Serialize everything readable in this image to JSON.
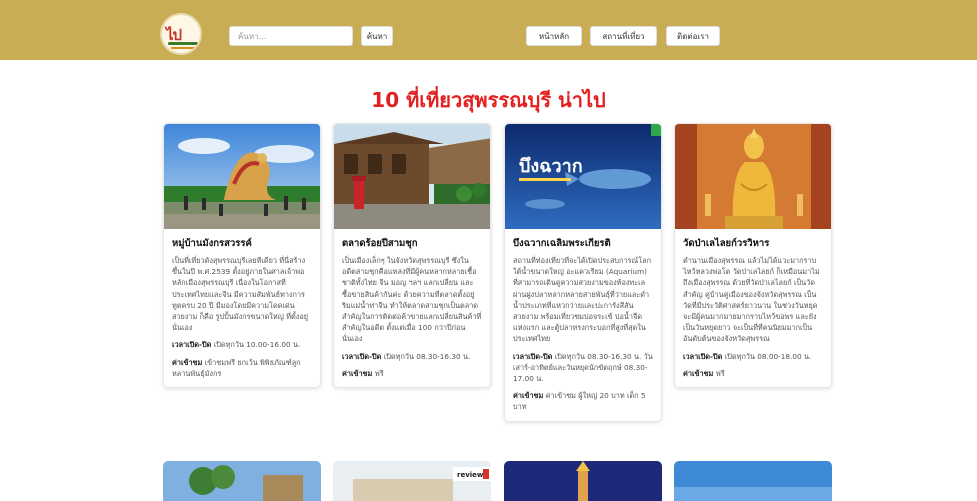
{
  "header": {
    "logo_alt": "ไปไหน",
    "search_placeholder": "ค้นหา...",
    "search_button": "ค้นหา",
    "nav": [
      {
        "label": "หน้าหลัก"
      },
      {
        "label": "สถานที่เที่ยว"
      },
      {
        "label": "ติดต่อเรา"
      }
    ]
  },
  "page_title": "10 ที่เที่ยวสุพรรณบุรี น่าไป",
  "cards": [
    {
      "name": "หมู่บ้านมังกรสวรรค์",
      "description": "เป็นที่เที่ยวดังสุพรรณบุรีเลยทีเดียว ที่นี่สร้างขึ้นในปี พ.ศ.2539 ตั้งอยู่ภายในศาลเจ้าพ่อหลักเมืองสุพรรณบุรี เนื่องในโอกาสที่ประเทศไทยและจีน มีความสัมพันธ์ทางการทูตครบ 20 ปี มีมองโดยมีความโดดเด่นสวยงาม ก็คือ รูปปั้นมังกรขนาดใหญ่ ที่ตั้งอยู่นั่นเอง",
      "hours_label": "เวลาเปิด-ปิด",
      "hours": "เปิดทุกวัน 10.00-16.00 น.",
      "fee_label": "ค่าเข้าชม",
      "fee": "เข้าชมฟรี ยกเว้น พิพิธภัณฑ์ลูกหลานพันธุ์มังกร"
    },
    {
      "name": "ตลาดร้อยปีสามชุก",
      "description": "เป็นเมืองเล็กๆ ในจังหวัดสุพรรณบุรี ซึ่งในอดีตสามชุกคือแหล่งที่มีผู้คนหลากหลายเชื้อชาติทั้งไทย จีน มอญ ฯลฯ แลกเปลี่ยน และซื้อขายสินค้ากันค่ะ ด้วยความที่ตลาดตั้งอยู่ริมแม่น้ำท่าจีน ทำให้ตลาดสามชุกเป็นตลาดสำคัญในการติดต่อค้าขายแลกเปลี่ยนสินค้าที่สำคัญในอดีต ตั้งแต่เมื่อ 100 กว่าปีก่อนนั่นเอง",
      "hours_label": "เวลาเปิด-ปิด",
      "hours": "เปิดทุกวัน 08.30-16.30 น.",
      "fee_label": "ค่าเข้าชม",
      "fee": "ฟรี"
    },
    {
      "name": "บึงฉวากเฉลิมพระเกียรติ",
      "badge": "บึงฉวาก",
      "description": "สถานที่ท่องเที่ยวที่จะได้เปิดประสบการณ์โลกใต้น้ำขนาดใหญ่ อะแควเรียม (Aquarium) ที่สามารถเดินดูความสวยงามของท้องทะเล ผ่านฝูงปลาหลากหลายสายพันธุ์ที่ว่ายและดำน้ำประเภทที่แหวกว่ายและปะการังสีสันสวยงาม พร้อมเที่ยวชมบ่อจระเข้ บ่อน้ำจืดแห่งแรก และตู้ปลาทรงกระบอกที่สูงที่สุดในประเทศไทย",
      "hours_label": "เวลาเปิด-ปิด",
      "hours": "เปิดทุกวัน 08.30-16.30 น. วันเสาร์-อาทิตย์และวันหยุดนักขัตฤกษ์ 08.30-17.00 น.",
      "fee_label": "ค่าเข้าชม",
      "fee": "ค่าเข้าชม ผู้ใหญ่ 20 บาท เด็ก 5 บาท"
    },
    {
      "name": "วัดป่าเลไลยก์วรวิหาร",
      "description": "ตำนานเมืองสุพรรณ แล้วไม่ได้แวะมากราบไหว้หลวงพ่อโต วัดป่าเลไลยก์ ก็เหมือนมาไม่ถึงเมืองสุพรรณ ด้วยที่วัดป่าเลไลยก์ เป็นวัดสำคัญ คู่บ้านคู่เมืองของจังหวัดสุพรรณ เป็นวัดที่มีประวัติศาสตร์ยาวนาน ในช่วงวันหยุดจะมีผู้คนมากมายมากราบไหว้ขอพร และยังเป็นวันหยุดยาว จะเป็นที่ที่คนนิยมมากเป็นอันดับต้นของจังหวัดสุพรรณ",
      "hours_label": "เวลาเปิด-ปิด",
      "hours": "เปิดทุกวัน 08.00-18.00 น.",
      "fee_label": "ค่าเข้าชม",
      "fee": "ฟรี"
    }
  ],
  "row2_badge": "review"
}
